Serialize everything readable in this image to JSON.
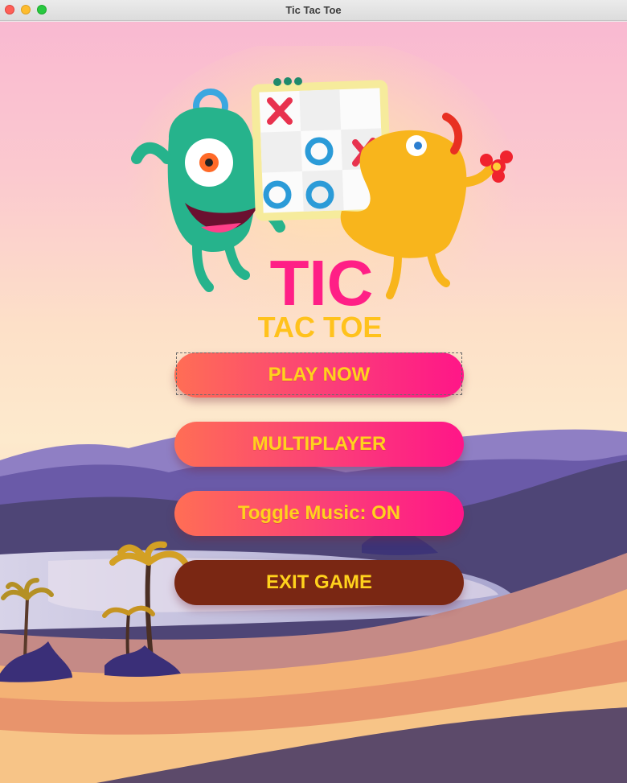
{
  "window": {
    "title": "Tic Tac Toe"
  },
  "logo": {
    "line1": "TIC",
    "line2": "TAC TOE"
  },
  "menu": {
    "play_label": "PLAY NOW",
    "multiplayer_label": "MULTIPLAYER",
    "music_label": "Toggle Music: ON",
    "exit_label": "EXIT GAME"
  },
  "colors": {
    "button_gradient_start": "#ff6e55",
    "button_gradient_end": "#ff1688",
    "button_text": "#ffd21d",
    "exit_button": "#7a2713",
    "logo_tic": "#ff1f86",
    "logo_tactoe": "#ffc21c"
  },
  "icons": [
    "green-monster-icon",
    "yellow-monster-icon",
    "tic-tac-toe-board-icon",
    "palm-tree-icon"
  ]
}
